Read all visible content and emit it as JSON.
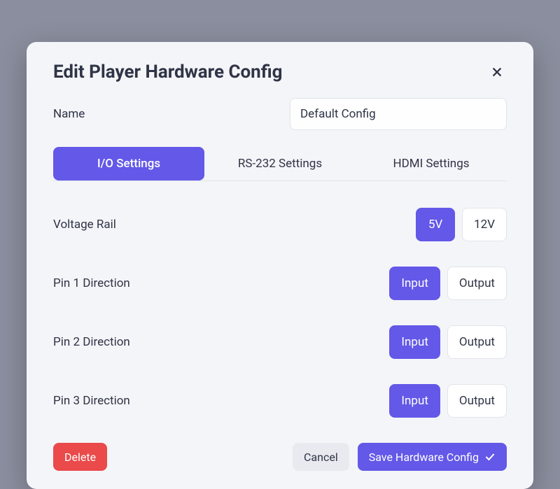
{
  "modal": {
    "title": "Edit Player Hardware Config",
    "name_label": "Name",
    "name_value": "Default Config",
    "tabs": [
      {
        "label": "I/O Settings",
        "active": true
      },
      {
        "label": "RS-232 Settings",
        "active": false
      },
      {
        "label": "HDMI Settings",
        "active": false
      }
    ],
    "settings": [
      {
        "label": "Voltage Rail",
        "options": [
          "5V",
          "12V"
        ],
        "selected": "5V"
      },
      {
        "label": "Pin 1 Direction",
        "options": [
          "Input",
          "Output"
        ],
        "selected": "Input"
      },
      {
        "label": "Pin 2 Direction",
        "options": [
          "Input",
          "Output"
        ],
        "selected": "Input"
      },
      {
        "label": "Pin 3 Direction",
        "options": [
          "Input",
          "Output"
        ],
        "selected": "Input"
      }
    ],
    "footer": {
      "delete_label": "Delete",
      "cancel_label": "Cancel",
      "save_label": "Save Hardware Config"
    }
  }
}
